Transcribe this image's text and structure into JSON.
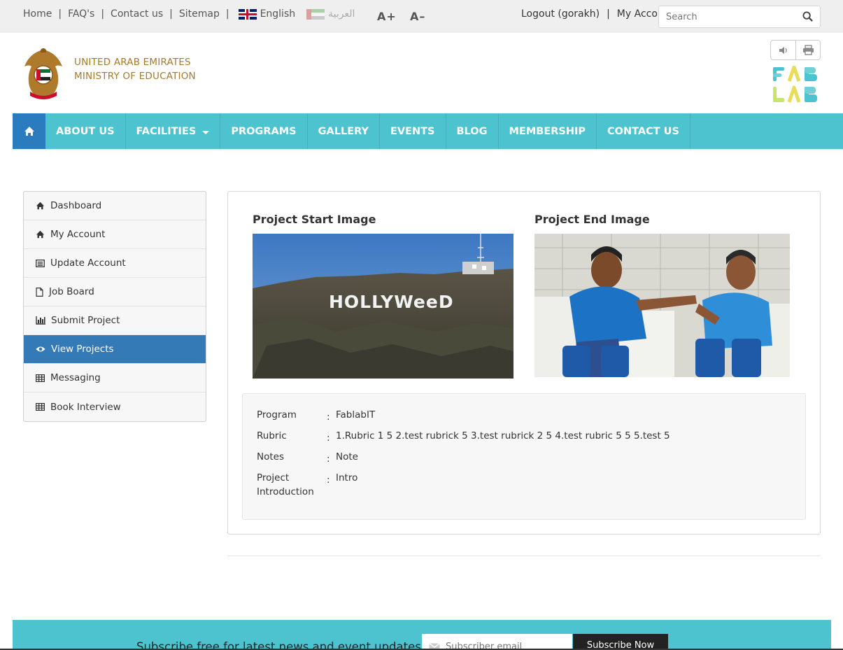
{
  "topbar": {
    "links": [
      "Home",
      "FAQ's",
      "Contact us",
      "Sitemap"
    ],
    "lang_english": "English",
    "lang_arabic": "العربية",
    "font_increase": "A+",
    "font_decrease": "A–",
    "logout": "Logout (gorakh)",
    "my_account": "My Account",
    "search_placeholder": "Search"
  },
  "header": {
    "logo_line1": "UNITED ARAB EMIRATES",
    "logo_line2": "MINISTRY OF EDUCATION",
    "fablab_line1": "FAB",
    "fablab_line2": "LAB"
  },
  "nav": {
    "items": [
      "ABOUT US",
      "FACILITIES",
      "PROGRAMS",
      "GALLERY",
      "EVENTS",
      "BLOG",
      "MEMBERSHIP",
      "CONTACT US"
    ]
  },
  "sidebar": {
    "items": [
      {
        "label": "Dashboard",
        "icon": "home-icon"
      },
      {
        "label": "My Account",
        "icon": "home-icon"
      },
      {
        "label": "Update Account",
        "icon": "list-icon"
      },
      {
        "label": "Job Board",
        "icon": "file-icon"
      },
      {
        "label": "Submit Project",
        "icon": "bar-chart-icon"
      },
      {
        "label": "View Projects",
        "icon": "eye-icon",
        "active": true
      },
      {
        "label": "Messaging",
        "icon": "table-icon"
      },
      {
        "label": "Book Interview",
        "icon": "table-icon"
      }
    ]
  },
  "project": {
    "start_image_title": "Project Start Image",
    "end_image_title": "Project End Image",
    "start_image_sign_text": "HOLLYWeeD",
    "fields": [
      {
        "key": "Program",
        "value": "FablabIT"
      },
      {
        "key": "Rubric",
        "value": "1.Rubric 1 5 2.test rubrick 5 3.test rubrick 2 5 4.test rubric 5 5 5.test 5"
      },
      {
        "key": "Notes",
        "value": "Note"
      },
      {
        "key": "Project Introduction",
        "value": "Intro"
      }
    ]
  },
  "footer": {
    "subscribe_text": "Subscribe free for latest news and event updates",
    "email_placeholder": "Subscriber email",
    "subscribe_button": "Subscribe Now"
  },
  "colors": {
    "nav_bg": "#4ec3d0",
    "home_bg": "#2b7bbf",
    "active_bg": "#337ab7",
    "logo_gold": "#a57a2a"
  }
}
